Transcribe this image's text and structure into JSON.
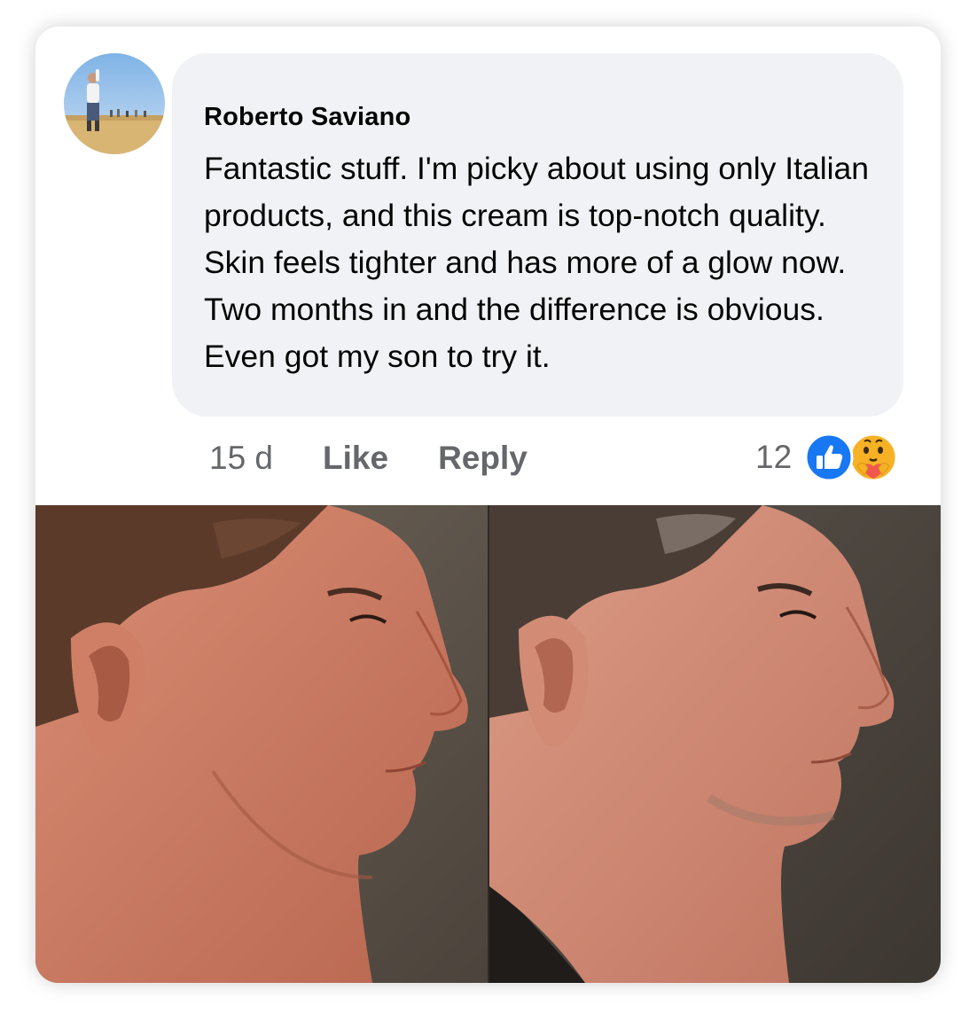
{
  "comment": {
    "author": "Roberto Saviano",
    "text": "Fantastic stuff. I'm picky about using only Italian products, and this cream is top-notch quality. Skin feels tighter and has more of a glow now. Two months in and the difference is obvious. Even got my son to try it.",
    "time": "15 d",
    "like_label": "Like",
    "reply_label": "Reply",
    "reaction_count": "12",
    "reaction_icons": [
      "like-icon",
      "care-icon"
    ]
  },
  "colors": {
    "bubble_bg": "#f0f2f5",
    "text": "#050505",
    "secondary_text": "#65676b",
    "like_blue": "#1877f2",
    "care_yellow": "#f7b125"
  }
}
